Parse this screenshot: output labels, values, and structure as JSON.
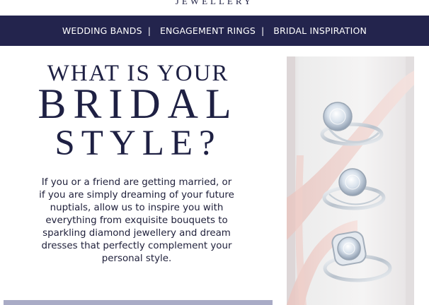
{
  "header": {
    "brand": "JEWELLERY"
  },
  "nav": {
    "items": [
      {
        "label": "WEDDING BANDS",
        "separator": "|"
      },
      {
        "label": "ENGAGEMENT RINGS",
        "separator": "|"
      },
      {
        "label": "BRIDAL INSPIRATION"
      }
    ]
  },
  "hero": {
    "headline_line1": "WHAT IS YOUR",
    "headline_line2": "BRIDAL",
    "headline_line3": "STYLE?",
    "body": "If you or a friend are getting married, or if you are simply dreaming of your future nuptials, allow us to inspire you with everything from exquisite bouquets to sparkling diamond jewellery and dream dresses that perfectly complement your personal style."
  },
  "colors": {
    "navy": "#23244d",
    "text": "#1e2043",
    "bar": "#a9abc6",
    "ribbon": "#f0d4cf"
  },
  "image": {
    "icon": "engagement-rings-photo"
  }
}
